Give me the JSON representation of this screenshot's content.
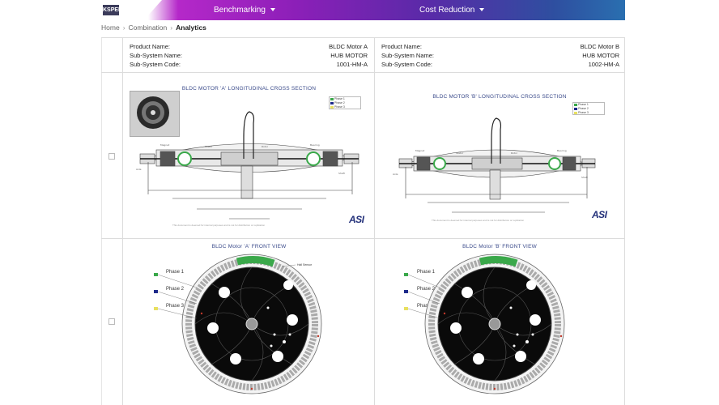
{
  "header": {
    "logo_text": "KSPEP",
    "nav": [
      {
        "label": "Benchmarking"
      },
      {
        "label": "Cost Reduction"
      }
    ]
  },
  "breadcrumb": [
    "Home",
    "Combination",
    "Analytics"
  ],
  "products": [
    {
      "name_key": "Product Name:",
      "name": "BLDC Motor A",
      "subsystem_key": "Sub-System Name:",
      "subsystem": "HUB MOTOR",
      "code_key": "Sub-System Code:",
      "code": "1001-HM-A"
    },
    {
      "name_key": "Product Name:",
      "name": "BLDC Motor B",
      "subsystem_key": "Sub-System Name:",
      "subsystem": "HUB MOTOR",
      "code_key": "Sub-System Code:",
      "code": "1002-HM-A"
    }
  ],
  "cross_section": {
    "titles": [
      "BLDC MOTOR 'A' LONGITUDINAL CROSS SECTION",
      "BLDC MOTOR 'B' LONGITUDINAL CROSS SECTION"
    ],
    "legend": [
      "Phase 1",
      "Phase 2",
      "Phase 3"
    ],
    "brand": "ASI",
    "footnotes": [
      "This document is deemed for internal purposes and is not for distribution or replication",
      "This document is deemed for internal purposes and is not for distribution or replication"
    ]
  },
  "front_view": {
    "titles": [
      "BLDC Motor 'A' FRONT VIEW",
      "BLDC Motor 'B' FRONT VIEW"
    ],
    "phases": [
      "Phase 1",
      "Phase 2",
      "Phase 3"
    ],
    "hall_label": "Hall Sensor"
  },
  "colors": {
    "phase1": "#3aa84a",
    "phase2": "#1d2a8a",
    "phase3": "#e8e060",
    "accent": "#8c1fb8"
  }
}
